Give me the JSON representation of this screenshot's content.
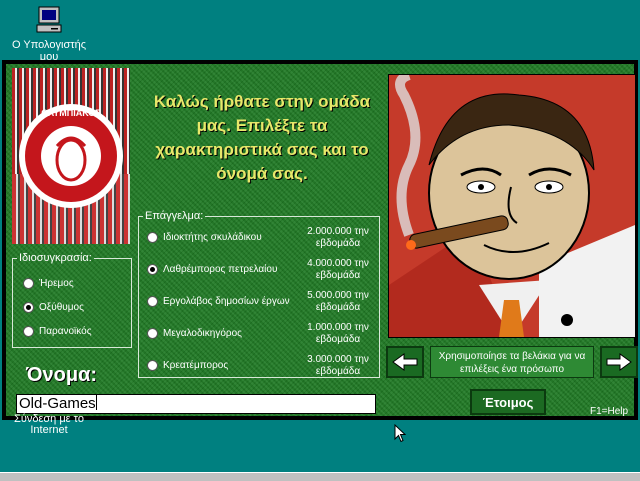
{
  "desktop": {
    "icon_computer_label": "Ο Υπολογιστής μου",
    "icon_internet_label": "Σύνδεση με το Internet"
  },
  "game": {
    "welcome_text": "Καλώς ήρθατε στην ομάδα μας. Επιλέξτε τα χαρακτηριστικά σας και το όνομά σας.",
    "temperament": {
      "legend": "Ιδιοσυγκρασία:",
      "options": [
        "Ήρεμος",
        "Οξύθυμος",
        "Παρανοϊκός"
      ],
      "selected": "Οξύθυμος"
    },
    "profession": {
      "legend": "Επάγγελμα:",
      "options": [
        {
          "label": "Ιδιοκτήτης σκυλάδικου",
          "amount": "2.000.000 την",
          "period": "εβδομάδα"
        },
        {
          "label": "Λαθρέμπορος πετρελαίου",
          "amount": "4.000.000 την",
          "period": "εβδομάδα"
        },
        {
          "label": "Εργολάβος δημοσίων έργων",
          "amount": "5.000.000 την",
          "period": "εβδομάδα"
        },
        {
          "label": "Μεγαλοδικηγόρος",
          "amount": "1.000.000 την",
          "period": "εβδομάδα"
        },
        {
          "label": "Κρεατέμπορος",
          "amount": "3.000.000 την",
          "period": "εβδομάδα"
        }
      ],
      "selected": "Λαθρέμπορος πετρελαίου"
    },
    "name_label": "Όνομα:",
    "name_value": "Old-Games",
    "nav_hint": "Χρησιμοποίησε τα βελάκια για να επιλέξεις ένα πρόσωπο",
    "ready_label": "Έτοιμος",
    "help_label": "F1=Help"
  },
  "colors": {
    "desktop": "#008080",
    "felt_green": "#1f7a24",
    "title_yellow": "#e8e86a",
    "portrait_red": "#c53a2a"
  }
}
